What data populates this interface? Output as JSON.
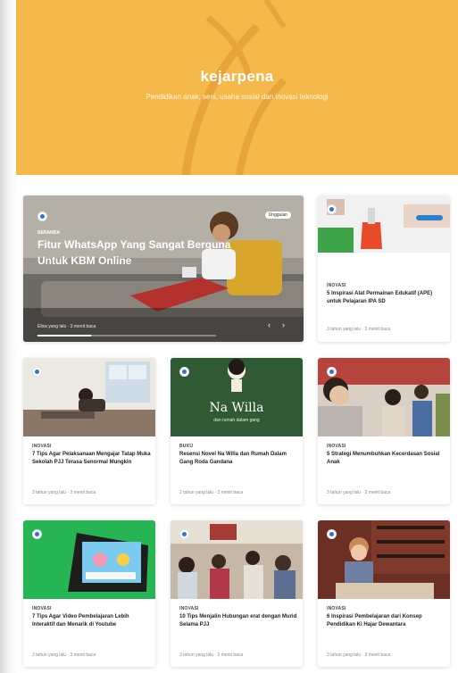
{
  "site": {
    "title": "kejarpena",
    "tagline": "Pendidikan anak, seni, usaha sosial dan inovasi teknologi"
  },
  "hero": {
    "category": "BERANDA",
    "title": "Fitur WhatsApp Yang Sangat Berguna Untuk KBM Online",
    "meta": "Elisa yang lalu · 3 menit baca",
    "pill": "Unggulan",
    "progress": 0.3
  },
  "side_card": {
    "category": "INOVASI",
    "title": "5 Inspirasi Alat Permainan Edukatif (APE) untuk Pelajaran IPA SD",
    "meta": "3 tahun yang lalu · 3 menit baca"
  },
  "cards": [
    {
      "category": "INOVASI",
      "title": "7 Tips Agar Pelaksanaan Mengajar Tatap Muka Sekolah PJJ Terasa Senormal Mungkin",
      "meta": "3 tahun yang lalu · 3 menit baca"
    },
    {
      "category": "BUKU",
      "title": "Resensi Novel Na Willa dan Rumah Dalam Gang Roda Gandana",
      "meta": "2 tahun yang lalu · 3 menit baca",
      "image_text": "Na Willa",
      "image_subtext": "dan rumah dalam gang"
    },
    {
      "category": "INOVASI",
      "title": "5 Strategi Menumbuhkan Kecerdasan Sosial Anak",
      "meta": "3 tahun yang lalu · 3 menit baca"
    },
    {
      "category": "INOVASI",
      "title": "7 Tips Agar Video Pembelajaran Lebih Interaktif dan Menarik di Youtube",
      "meta": "3 tahun yang lalu · 3 menit baca"
    },
    {
      "category": "INOVASI",
      "title": "10 Tips Menjalin Hubungan erat dengan Murid Selama PJJ",
      "meta": "3 tahun yang lalu · 3 menit baca"
    },
    {
      "category": "INOVASI",
      "title": "6 Inspirasi Pembelajaran dari Konsep Pendidikan Ki Hajar Dewantara",
      "meta": "3 tahun yang lalu · 3 menit baca"
    }
  ],
  "colors": {
    "header": "#f5b84a",
    "accent": "#3a6ec9"
  }
}
